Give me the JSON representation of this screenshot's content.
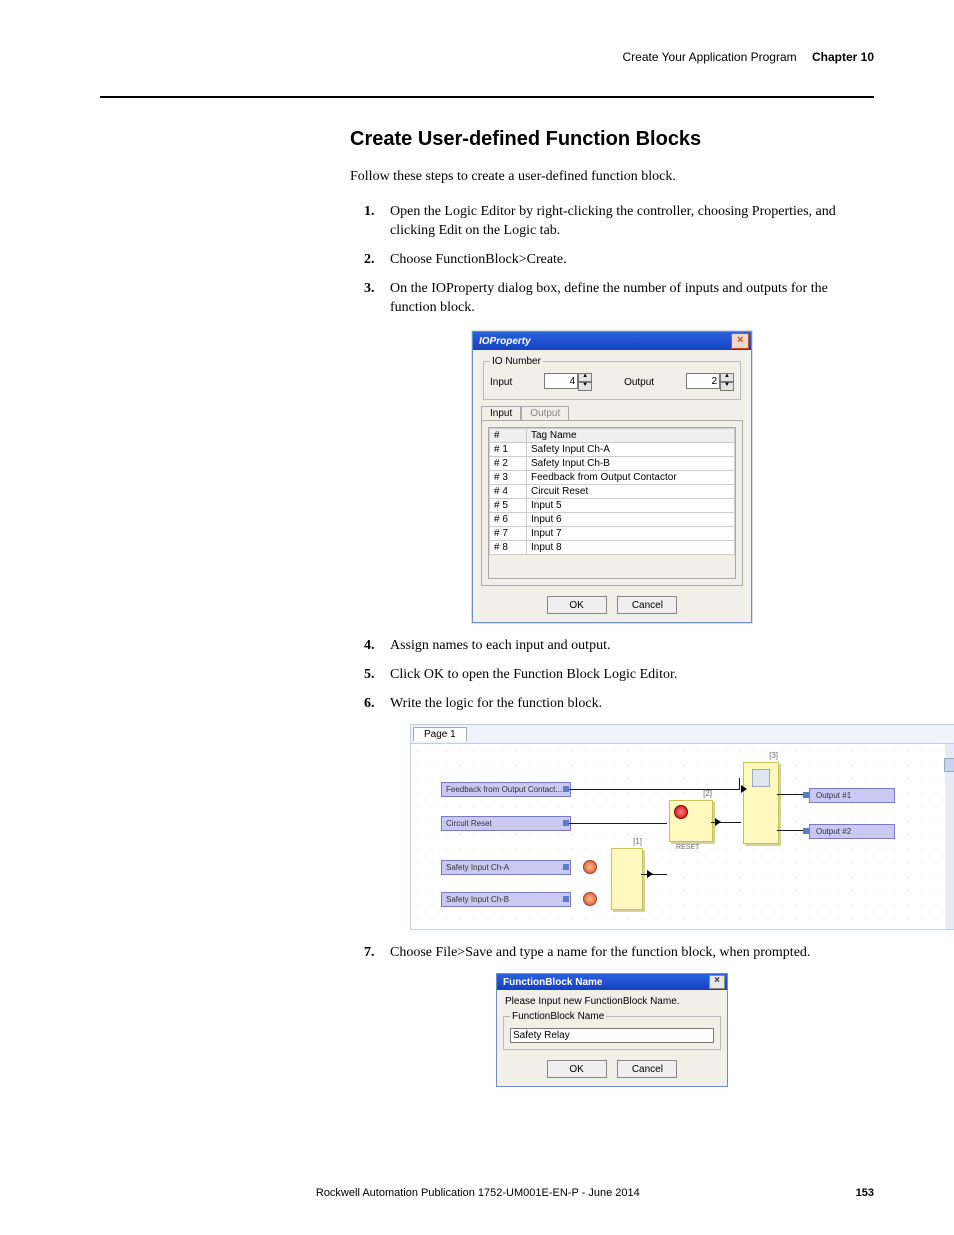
{
  "header": {
    "breadcrumb": "Create Your Application Program",
    "chapter": "Chapter 10"
  },
  "title": "Create User-defined Function Blocks",
  "intro": "Follow these steps to create a user-defined function block.",
  "steps": {
    "s1": "Open the Logic Editor by right-clicking the controller, choosing Properties, and clicking Edit on the Logic tab.",
    "s2": "Choose FunctionBlock>Create.",
    "s3": "On the IOProperty dialog box, define the number of inputs and outputs for the function block.",
    "s4": "Assign names to each input and output.",
    "s5": "Click OK to open the Function Block Logic Editor.",
    "s6": "Write the logic for the function block.",
    "s7": "Choose File>Save and type a name for the function block, when prompted."
  },
  "ioproperty": {
    "title": "IOProperty",
    "group": "IO Number",
    "input_label": "Input",
    "input_value": "4",
    "output_label": "Output",
    "output_value": "2",
    "tab_input": "Input",
    "tab_output": "Output",
    "col_num": "#",
    "col_tag": "Tag Name",
    "rows": [
      {
        "n": "# 1",
        "t": "Safety Input Ch-A"
      },
      {
        "n": "# 2",
        "t": "Safety Input Ch-B"
      },
      {
        "n": "# 3",
        "t": "Feedback from Output Contactor"
      },
      {
        "n": "# 4",
        "t": "Circuit Reset"
      },
      {
        "n": "# 5",
        "t": "Input 5"
      },
      {
        "n": "# 6",
        "t": "Input 6"
      },
      {
        "n": "# 7",
        "t": "Input 7"
      },
      {
        "n": "# 8",
        "t": "Input 8"
      }
    ],
    "ok": "OK",
    "cancel": "Cancel"
  },
  "editor": {
    "page_tab": "Page 1",
    "in_feedback": "Feedback from Output Contact...",
    "in_reset": "Circuit Reset",
    "in_cha": "Safety Input Ch-A",
    "in_chb": "Safety Input Ch-B",
    "out1": "Output #1",
    "out2": "Output #2",
    "reset_lbl": "RESET",
    "blk1": "[1]",
    "blk2": "[2]",
    "blk3": "[3]"
  },
  "fbname_dialog": {
    "title": "FunctionBlock Name",
    "prompt": "Please Input new FunctionBlock Name.",
    "group": "FunctionBlock Name",
    "value": "Safety Relay",
    "ok": "OK",
    "cancel": "Cancel"
  },
  "footer": {
    "pub": "Rockwell Automation Publication 1752-UM001E-EN-P - June 2014",
    "page": "153"
  }
}
